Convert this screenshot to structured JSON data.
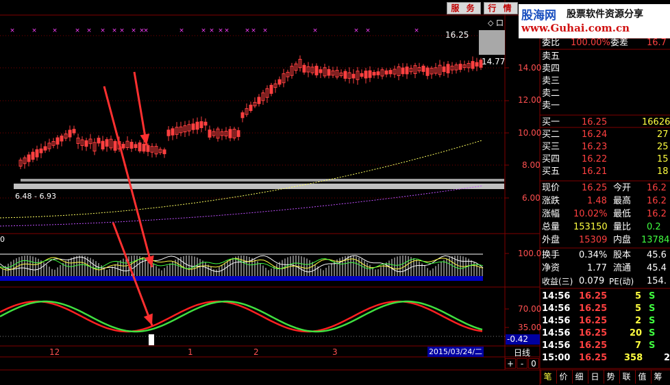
{
  "top_buttons": [
    "服 务",
    "行 情"
  ],
  "logo": {
    "site_name": "股海网",
    "slogan": "股票软件资源分享",
    "url": "www.Guhai.com.cn"
  },
  "title_icons": "◇ 口",
  "price_chart": {
    "price_high_label": "16.25",
    "last_price_label": "14.77",
    "range_label": "6.48 - 6.93",
    "y_axis": [
      "14.00",
      "12.00",
      "10.00",
      "8.00",
      "6.00"
    ]
  },
  "indicator1": {
    "left_label": "0",
    "y_axis": [
      "100.0"
    ]
  },
  "indicator2": {
    "y_axis": [
      "70.00",
      "35.00"
    ],
    "current_value": "-0.42"
  },
  "date_axis": {
    "labels": [
      "12",
      "1",
      "2",
      "3"
    ],
    "current_date": "2015/03/24/二",
    "period": "日线",
    "zoom_buttons": [
      "+",
      "-",
      "0"
    ]
  },
  "quote": {
    "weibi_label": "委比",
    "weibi_value": "100.00%",
    "weicha_label": "委差",
    "weicha_value": "16.7",
    "sell": [
      {
        "label": "卖五"
      },
      {
        "label": "卖四"
      },
      {
        "label": "卖三"
      },
      {
        "label": "卖二"
      },
      {
        "label": "卖一"
      }
    ],
    "buy": [
      {
        "label": "买一",
        "price": "16.25",
        "vol": "16626"
      },
      {
        "label": "买二",
        "price": "16.24",
        "vol": "27"
      },
      {
        "label": "买三",
        "price": "16.23",
        "vol": "25"
      },
      {
        "label": "买四",
        "price": "16.22",
        "vol": "15"
      },
      {
        "label": "买五",
        "price": "16.21",
        "vol": "18"
      }
    ],
    "stats": [
      {
        "l1": "现价",
        "v1": "16.25",
        "l2": "今开",
        "v2": "16.2"
      },
      {
        "l1": "涨跌",
        "v1": "1.48",
        "l2": "最高",
        "v2": "16.2"
      },
      {
        "l1": "涨幅",
        "v1": "10.02%",
        "l2": "最低",
        "v2": "16.2"
      },
      {
        "l1": "总量",
        "v1": "153150",
        "l2": "量比",
        "v2": "0.2"
      },
      {
        "l1": "外盘",
        "v1": "15309",
        "l2": "内盘",
        "v2": "13784"
      },
      {
        "l1": "换手",
        "v1": "0.34%",
        "l2": "股本",
        "v2": "45.6"
      },
      {
        "l1": "净资",
        "v1": "1.77",
        "l2": "流通",
        "v2": "45.4"
      },
      {
        "l1": "收益(三)",
        "v1": "0.079",
        "l2": "PE(动)",
        "v2": "154."
      }
    ],
    "ticks": [
      {
        "time": "14:56",
        "price": "16.25",
        "vol": "5",
        "side": "S"
      },
      {
        "time": "14:56",
        "price": "16.25",
        "vol": "5",
        "side": "S"
      },
      {
        "time": "14:56",
        "price": "16.25",
        "vol": "2",
        "side": "S"
      },
      {
        "time": "14:56",
        "price": "16.25",
        "vol": "20",
        "side": "S"
      },
      {
        "time": "14:56",
        "price": "16.25",
        "vol": "7",
        "side": "S"
      },
      {
        "time": "15:00",
        "price": "16.25",
        "vol": "358",
        "side": "2"
      }
    ]
  },
  "bottom_tabs": [
    "笔",
    "价",
    "细",
    "日",
    "势",
    "联",
    "值",
    "筹"
  ],
  "colors": {
    "up": "#ff4040",
    "down": "#40ffff",
    "grid": "#800000",
    "ma_yellow": "#ffff60",
    "ma_purple": "#c050ff",
    "kdj_green": "#40e040",
    "kdj_red": "#ff2020",
    "arrow": "#ff3030"
  }
}
